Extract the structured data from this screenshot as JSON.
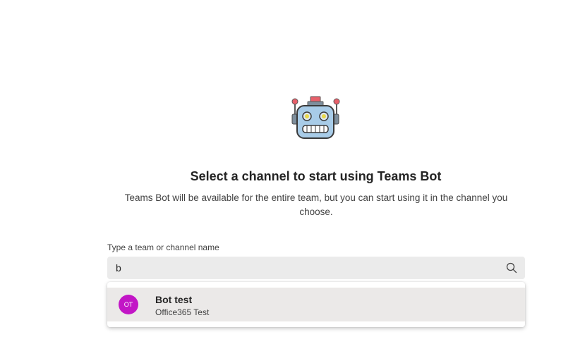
{
  "header": {
    "icon": "robot-icon",
    "title": "Select a channel to start using Teams Bot",
    "subtitle": "Teams Bot will be available for the entire team, but you can start using it in the channel you choose."
  },
  "search": {
    "label": "Type a team or channel name",
    "value": "b",
    "icon": "search-icon"
  },
  "results": [
    {
      "avatar_initials": "OT",
      "avatar_color": "#c216c6",
      "title": "Bot test",
      "subtitle": "Office365 Test"
    }
  ],
  "colors": {
    "search_bg": "#ebebeb",
    "selected_item_bg": "#ebe9e8"
  }
}
